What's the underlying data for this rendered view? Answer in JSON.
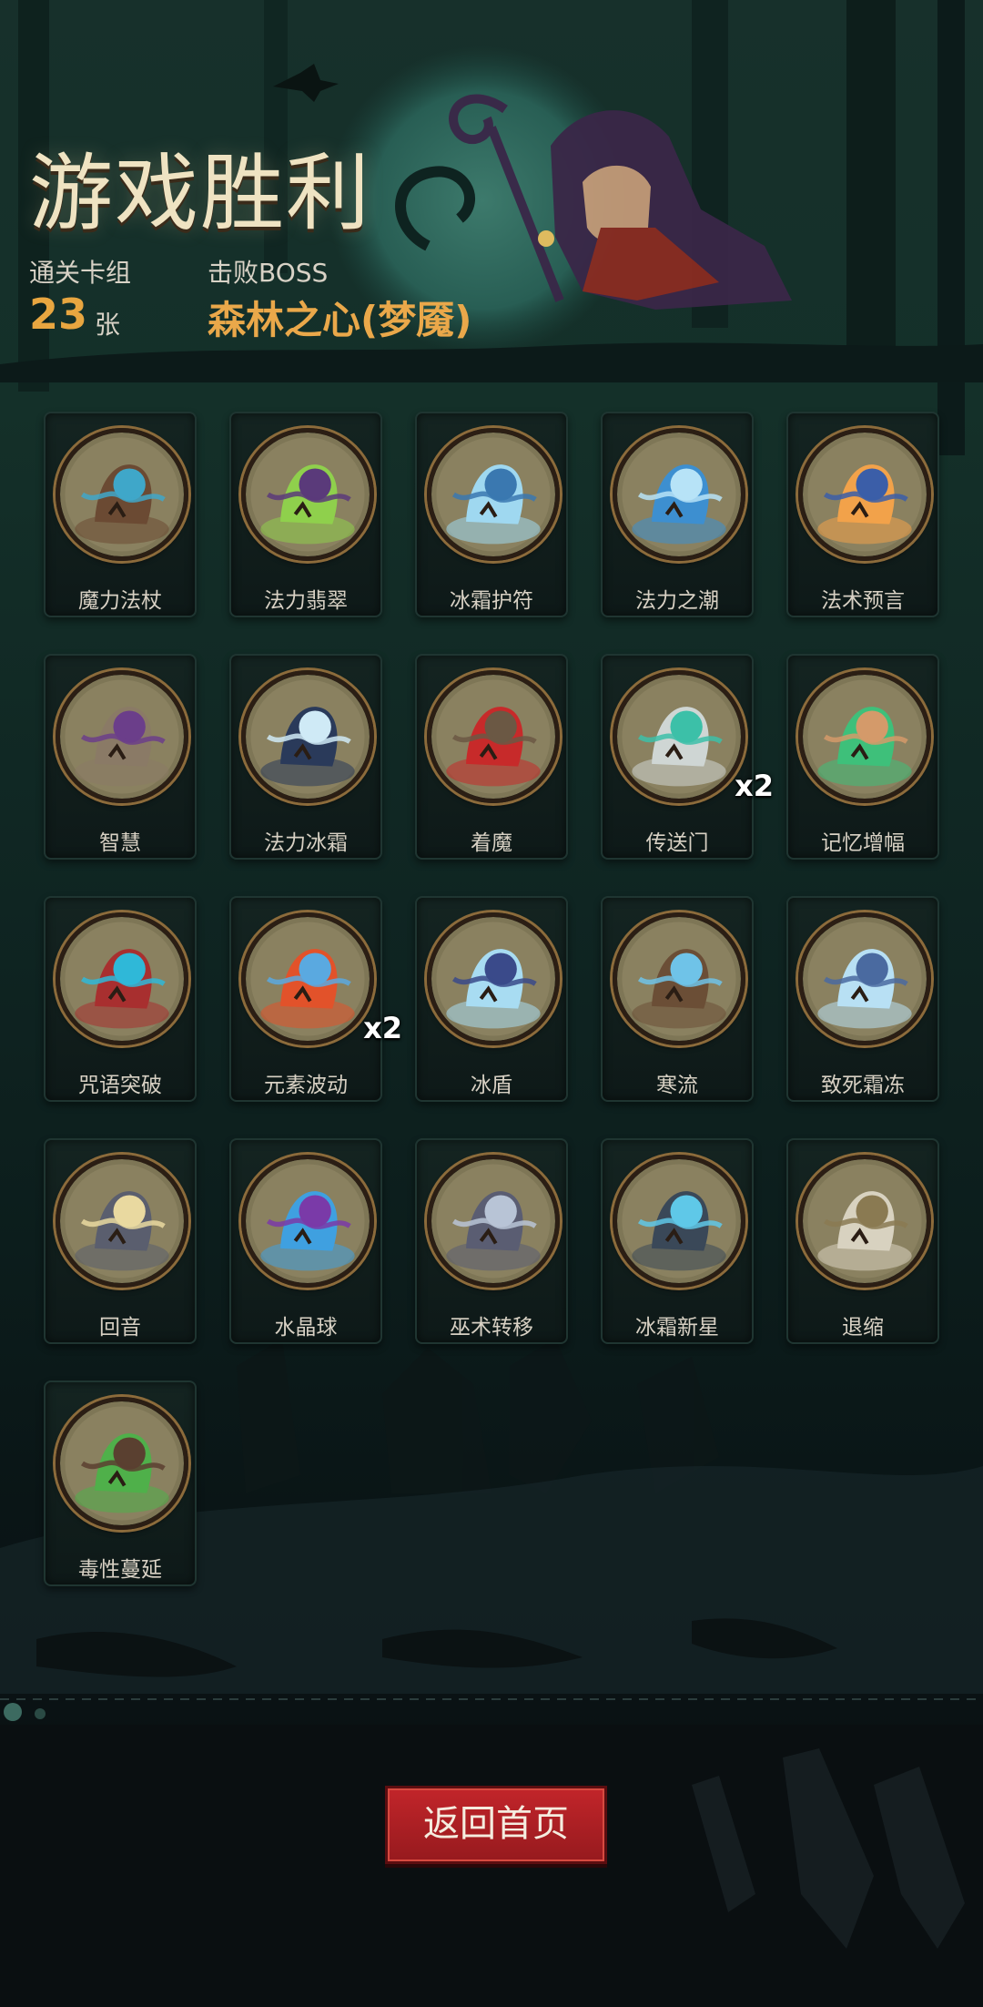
{
  "header": {
    "title": "游戏胜利",
    "deck_label": "通关卡组",
    "deck_count": "23",
    "deck_unit": "张",
    "boss_label": "击败BOSS",
    "boss_name": "森林之心(梦魇)"
  },
  "cards": [
    {
      "name": "魔力法杖",
      "icon": "staff-icon",
      "colors": [
        "#6b4a33",
        "#3fa7c9"
      ]
    },
    {
      "name": "法力翡翠",
      "icon": "emerald-icon",
      "colors": [
        "#8fd04c",
        "#5a3a7a"
      ]
    },
    {
      "name": "冰霜护符",
      "icon": "frost-amulet-icon",
      "colors": [
        "#9fd8f0",
        "#3a78b0"
      ]
    },
    {
      "name": "法力之潮",
      "icon": "wave-icon",
      "colors": [
        "#3d8fd0",
        "#b7e3f7"
      ]
    },
    {
      "name": "法术预言",
      "icon": "orb-prophecy-icon",
      "colors": [
        "#f2a24a",
        "#3b5ea8"
      ]
    },
    {
      "name": "智慧",
      "icon": "wise-man-icon",
      "colors": [
        "#8a7a66",
        "#6b3e8a"
      ]
    },
    {
      "name": "法力冰霜",
      "icon": "frost-hands-icon",
      "colors": [
        "#2a3a5a",
        "#cfeaf6"
      ]
    },
    {
      "name": "着魔",
      "icon": "possessed-icon",
      "colors": [
        "#c72a2a",
        "#6b5844"
      ]
    },
    {
      "name": "传送门",
      "icon": "portal-icon",
      "colors": [
        "#cfd6d4",
        "#3cc0a8"
      ],
      "multiplier": "x2"
    },
    {
      "name": "记忆增幅",
      "icon": "brain-icon",
      "colors": [
        "#3ec07a",
        "#d49a6a"
      ]
    },
    {
      "name": "咒语突破",
      "icon": "spell-break-icon",
      "colors": [
        "#a82f2f",
        "#2fb8d8"
      ]
    },
    {
      "name": "元素波动",
      "icon": "elemental-wave-icon",
      "colors": [
        "#e2522a",
        "#5aa9e0"
      ],
      "multiplier": "x2"
    },
    {
      "name": "冰盾",
      "icon": "ice-shield-icon",
      "colors": [
        "#a8dcf2",
        "#3a4a8a"
      ]
    },
    {
      "name": "寒流",
      "icon": "cold-current-icon",
      "colors": [
        "#6b4e36",
        "#6fc3e8"
      ]
    },
    {
      "name": "致死霜冻",
      "icon": "deadly-frost-icon",
      "colors": [
        "#b8e0f4",
        "#4a6aa0"
      ]
    },
    {
      "name": "回音",
      "icon": "werewolf-icon",
      "colors": [
        "#5a5e6e",
        "#e9d9a0"
      ]
    },
    {
      "name": "水晶球",
      "icon": "crystal-ball-icon",
      "colors": [
        "#3fa0e0",
        "#7a3aa8"
      ]
    },
    {
      "name": "巫术转移",
      "icon": "wizard-icon",
      "colors": [
        "#5a5d72",
        "#b8c4d6"
      ]
    },
    {
      "name": "冰霜新星",
      "icon": "frost-nova-icon",
      "colors": [
        "#3a4858",
        "#5fc8e8"
      ]
    },
    {
      "name": "退缩",
      "icon": "retreat-icon",
      "colors": [
        "#d8d2c0",
        "#8a7a52"
      ]
    },
    {
      "name": "毒性蔓延",
      "icon": "poison-spread-icon",
      "colors": [
        "#4fb04a",
        "#5a4030"
      ]
    }
  ],
  "footer": {
    "home_button": "返回首页"
  }
}
